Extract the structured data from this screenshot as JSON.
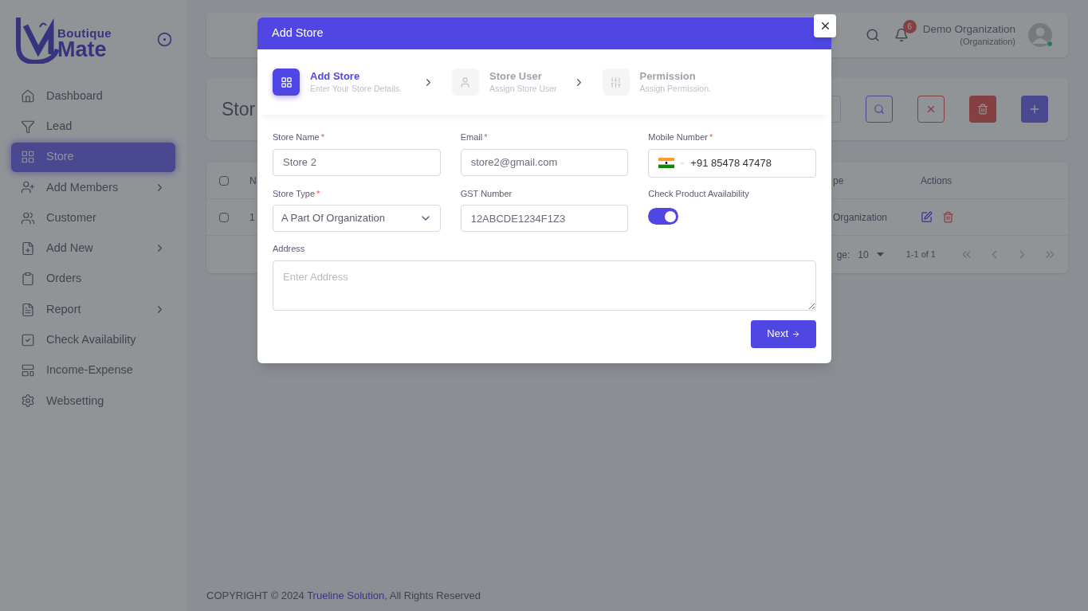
{
  "sidebar": {
    "logo": {
      "line1": "Boutique",
      "line2": "Mate"
    },
    "items": [
      {
        "label": "Dashboard",
        "selected": false,
        "submenu": false
      },
      {
        "label": "Lead",
        "selected": false,
        "submenu": false
      },
      {
        "label": "Store",
        "selected": true,
        "submenu": false
      },
      {
        "label": "Add Members",
        "selected": false,
        "submenu": true
      },
      {
        "label": "Customer",
        "selected": false,
        "submenu": false
      },
      {
        "label": "Add New",
        "selected": false,
        "submenu": true
      },
      {
        "label": "Orders",
        "selected": false,
        "submenu": false
      },
      {
        "label": "Report",
        "selected": false,
        "submenu": true
      },
      {
        "label": "Check Availability",
        "selected": false,
        "submenu": false
      },
      {
        "label": "Income-Expense",
        "selected": false,
        "submenu": false
      },
      {
        "label": "Websetting",
        "selected": false,
        "submenu": false
      }
    ]
  },
  "header": {
    "notification_count": "6",
    "user_name": "Demo Organization",
    "user_role": "(Organization)",
    "online": true
  },
  "page_title": "Stor",
  "table": {
    "columns": [
      "N",
      "pe",
      "Actions"
    ],
    "rows": [
      {
        "checked": false,
        "column_1": "1",
        "column_2": "Organization"
      }
    ],
    "header_checked": false,
    "pagination": {
      "rows_label": "ge:",
      "rows_value": "10",
      "range": "1-1 of 1"
    }
  },
  "modal": {
    "title": "Add Store",
    "steps": [
      {
        "title": "Add Store",
        "subtitle": "Enter Your Store Details.",
        "selected": true
      },
      {
        "title": "Store User",
        "subtitle": "Assign Store User",
        "selected": false
      },
      {
        "title": "Permission",
        "subtitle": "Assign Permission.",
        "selected": false
      }
    ],
    "fields": [
      {
        "kind": "text",
        "label": "Store Name",
        "required_mark": "*",
        "value": "Store 2"
      },
      {
        "kind": "text",
        "label": "Email",
        "required_mark": "*",
        "value": "store2@gmail.com"
      },
      {
        "kind": "phone",
        "label": "Mobile Number",
        "required_mark": "*",
        "value": "+91 85478 47478"
      },
      {
        "kind": "select",
        "label": "Store Type",
        "required_mark": "*",
        "value": "A Part Of Organization"
      },
      {
        "kind": "text",
        "label": "GST Number",
        "value": "12ABCDE1234F1Z3"
      },
      {
        "kind": "toggle",
        "label": "Check Product Availability",
        "on": true
      }
    ],
    "address": {
      "label": "Address",
      "placeholder": "Enter Address"
    },
    "next_button": "Next"
  },
  "footer": {
    "prefix": "COPYRIGHT © 2024 ",
    "link": "Trueline Solution",
    "suffix": ", All Rights Reserved"
  }
}
